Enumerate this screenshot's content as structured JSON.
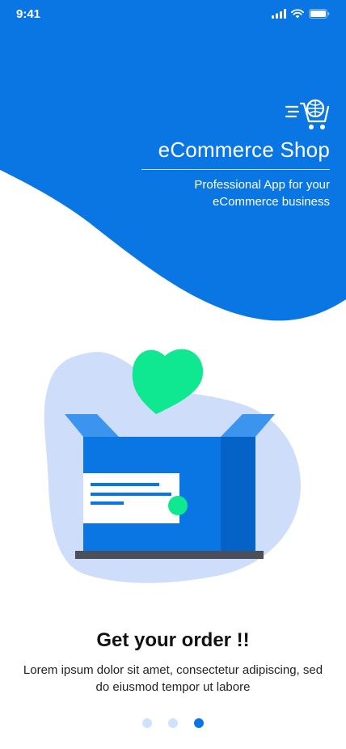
{
  "status_bar": {
    "time": "9:41"
  },
  "brand": {
    "title": "eCommerce Shop",
    "subtitle": "Professional App for your\neCommerce business",
    "logo_icon": "shopping-cart-icon"
  },
  "onboarding": {
    "title": "Get your order !!",
    "description": "Lorem ipsum dolor sit amet, consectetur adipiscing, sed do eiusmod tempor ut labore"
  },
  "pager": {
    "total": 3,
    "active_index": 2
  },
  "colors": {
    "primary": "#0a76e4",
    "primary_dark": "#0562c7",
    "accent_green": "#0fe890",
    "blob": "#cdddfa",
    "dot_inactive": "#cfe2fa"
  }
}
